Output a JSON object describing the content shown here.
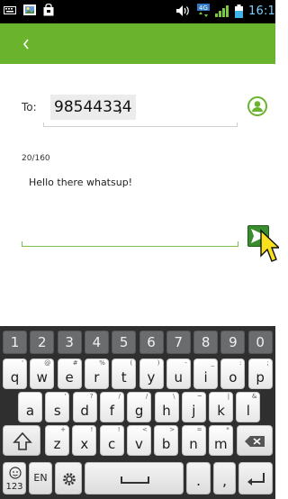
{
  "status_bar": {
    "left_icons": [
      "keyboard-icon",
      "photo-icon",
      "shopping-bag-icon"
    ],
    "right_icons": [
      "volume-icon",
      "network-4g-icon",
      "signal-icon",
      "battery-icon"
    ],
    "network_label": "4G",
    "time": "16:1",
    "time_color": "#7fd1ff"
  },
  "action_bar": {
    "color": "#6ab42d",
    "back_icon": "chevron-left-icon"
  },
  "compose": {
    "to_label": "To:",
    "recipient": "98544334",
    "recipient_separator": ",",
    "contact_icon": "person-icon",
    "char_counter": "20/160",
    "message": "Hello there whatsup!",
    "send_icon": "send-icon"
  },
  "keyboard": {
    "number_row": [
      "1",
      "2",
      "3",
      "4",
      "5",
      "6",
      "7",
      "8",
      "9",
      "0"
    ],
    "row1": [
      {
        "key": "q",
        "hint": "'"
      },
      {
        "key": "w",
        "hint": "@"
      },
      {
        "key": "e",
        "hint": "#"
      },
      {
        "key": "r",
        "hint": "%"
      },
      {
        "key": "t",
        "hint": "("
      },
      {
        "key": "y",
        "hint": ")"
      },
      {
        "key": "u",
        "hint": "-"
      },
      {
        "key": "i",
        "hint": "_"
      },
      {
        "key": "o",
        "hint": ":"
      },
      {
        "key": "p",
        "hint": ";"
      }
    ],
    "row2": [
      {
        "key": "a",
        "hint": ""
      },
      {
        "key": "s",
        "hint": "'"
      },
      {
        "key": "d",
        "hint": "?"
      },
      {
        "key": "f",
        "hint": "/"
      },
      {
        "key": "g",
        "hint": "/"
      },
      {
        "key": "h",
        "hint": "\\"
      },
      {
        "key": "j",
        "hint": "~"
      },
      {
        "key": "k",
        "hint": "|"
      },
      {
        "key": "l",
        "hint": "&"
      }
    ],
    "row3": [
      {
        "key": "z",
        "hint": "+"
      },
      {
        "key": "x",
        "hint": "!"
      },
      {
        "key": "c",
        "hint": "!"
      },
      {
        "key": "v",
        "hint": "<"
      },
      {
        "key": "b",
        "hint": ">"
      },
      {
        "key": "n",
        "hint": "="
      },
      {
        "key": "m",
        "hint": "*"
      }
    ],
    "shift_icon": "shift-icon",
    "backspace_icon": "backspace-icon",
    "emoji_key": "123",
    "lang_key": "EN",
    "settings_icon": "gear-icon",
    "space_icon": "space-icon",
    "period_key": ".",
    "comma_key": ",",
    "enter_icon": "enter-icon"
  }
}
